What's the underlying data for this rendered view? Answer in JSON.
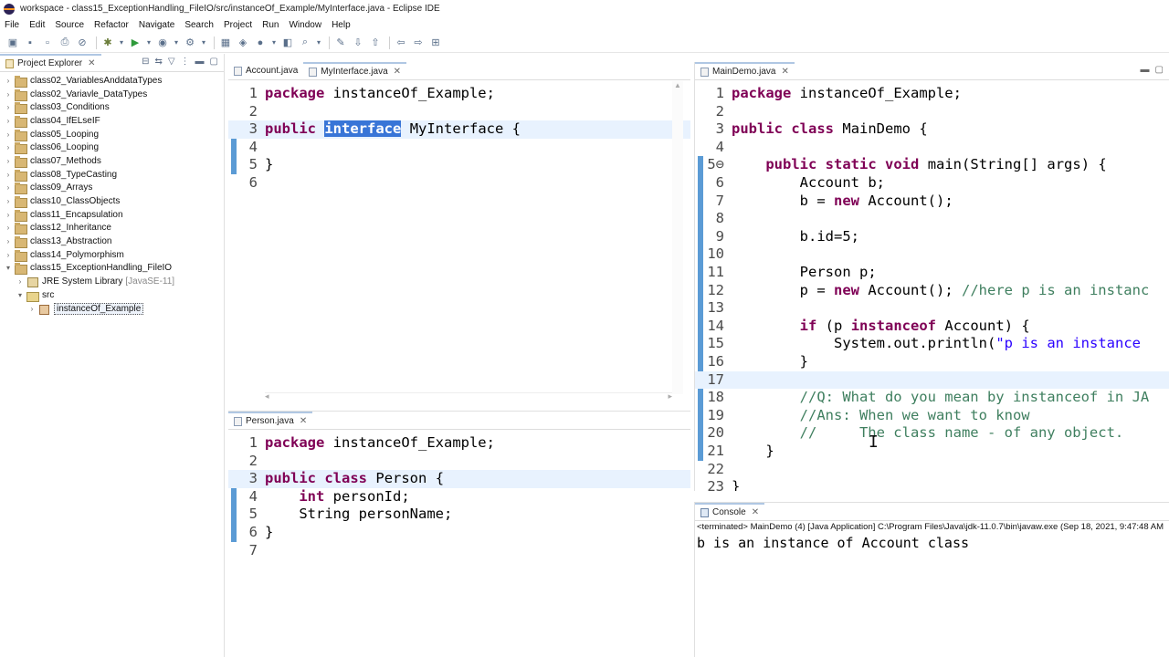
{
  "window": {
    "title": "workspace - class15_ExceptionHandling_FileIO/src/instanceOf_Example/MyInterface.java - Eclipse IDE"
  },
  "menu": [
    "File",
    "Edit",
    "Source",
    "Refactor",
    "Navigate",
    "Search",
    "Project",
    "Run",
    "Window",
    "Help"
  ],
  "toolbar_icons": [
    "new-icon",
    "save-icon",
    "save-all-icon",
    "print-icon",
    "skip-breakpoints-icon",
    "debug-icon",
    "run-icon",
    "coverage-icon",
    "external-tools-icon",
    "new-java-project-icon",
    "new-package-icon",
    "new-class-icon",
    "open-type-icon",
    "search-icon",
    "toggle-mark-occurrences-icon",
    "next-annotation-icon",
    "previous-annotation-icon",
    "back-icon",
    "forward-icon",
    "open-perspective-icon"
  ],
  "explorer": {
    "title": "Project Explorer",
    "items": [
      {
        "label": "class02_VariablesAnddataTypes",
        "depth": 0,
        "type": "project",
        "expanded": false
      },
      {
        "label": "class02_Variavle_DataTypes",
        "depth": 0,
        "type": "project",
        "expanded": false
      },
      {
        "label": "class03_Conditions",
        "depth": 0,
        "type": "project",
        "expanded": false
      },
      {
        "label": "class04_IfELseIF",
        "depth": 0,
        "type": "project",
        "expanded": false
      },
      {
        "label": "class05_Looping",
        "depth": 0,
        "type": "project",
        "expanded": false
      },
      {
        "label": "class06_Looping",
        "depth": 0,
        "type": "project",
        "expanded": false
      },
      {
        "label": "class07_Methods",
        "depth": 0,
        "type": "project",
        "expanded": false
      },
      {
        "label": "class08_TypeCasting",
        "depth": 0,
        "type": "project",
        "expanded": false
      },
      {
        "label": "class09_Arrays",
        "depth": 0,
        "type": "project",
        "expanded": false
      },
      {
        "label": "class10_ClassObjects",
        "depth": 0,
        "type": "project",
        "expanded": false
      },
      {
        "label": "class11_Encapsulation",
        "depth": 0,
        "type": "project",
        "expanded": false
      },
      {
        "label": "class12_Inheritance",
        "depth": 0,
        "type": "project",
        "expanded": false
      },
      {
        "label": "class13_Abstraction",
        "depth": 0,
        "type": "project",
        "expanded": false
      },
      {
        "label": "class14_Polymorphism",
        "depth": 0,
        "type": "project",
        "expanded": false
      },
      {
        "label": "class15_ExceptionHandling_FileIO",
        "depth": 0,
        "type": "project",
        "expanded": true
      },
      {
        "label": "JRE System Library",
        "extra": "[JavaSE-11]",
        "depth": 1,
        "type": "jre",
        "expanded": false
      },
      {
        "label": "src",
        "depth": 1,
        "type": "src",
        "expanded": true
      },
      {
        "label": "instanceOf_Example",
        "depth": 2,
        "type": "pkg",
        "expanded": false,
        "selected": true
      }
    ]
  },
  "editors": {
    "top_left": {
      "tabs": [
        {
          "label": "Account.java",
          "active": false,
          "closable": false
        },
        {
          "label": "MyInterface.java",
          "active": true,
          "closable": true
        }
      ],
      "lines": [
        {
          "n": "1",
          "text": "package instanceOf_Example;"
        },
        {
          "n": "2",
          "text": ""
        },
        {
          "n": "3",
          "text": "public interface MyInterface {"
        },
        {
          "n": "4",
          "text": ""
        },
        {
          "n": "5",
          "text": "}"
        },
        {
          "n": "6",
          "text": ""
        }
      ]
    },
    "bottom_left": {
      "tabs": [
        {
          "label": "Person.java",
          "active": true,
          "closable": true
        }
      ],
      "lines": [
        {
          "n": "1",
          "text": "package instanceOf_Example;"
        },
        {
          "n": "2",
          "text": ""
        },
        {
          "n": "3",
          "text": "public class Person {"
        },
        {
          "n": "4",
          "text": "    int personId;"
        },
        {
          "n": "5",
          "text": "    String personName;"
        },
        {
          "n": "6",
          "text": "}"
        },
        {
          "n": "7",
          "text": ""
        }
      ]
    },
    "right": {
      "tabs": [
        {
          "label": "MainDemo.java",
          "active": true,
          "closable": true
        }
      ],
      "lines": [
        {
          "n": "1",
          "text": "package instanceOf_Example;"
        },
        {
          "n": "2",
          "text": ""
        },
        {
          "n": "3",
          "text": "public class MainDemo {"
        },
        {
          "n": "4",
          "text": ""
        },
        {
          "n": "5⊖",
          "text": "    public static void main(String[] args) {"
        },
        {
          "n": "6",
          "text": "        Account b;"
        },
        {
          "n": "7",
          "text": "        b = new Account();"
        },
        {
          "n": "8",
          "text": ""
        },
        {
          "n": "9",
          "text": "        b.id=5;"
        },
        {
          "n": "10",
          "text": ""
        },
        {
          "n": "11",
          "text": "        Person p;"
        },
        {
          "n": "12",
          "text": "        p = new Account(); //here p is an instanc"
        },
        {
          "n": "13",
          "text": ""
        },
        {
          "n": "14",
          "text": "        if (p instanceof Account) {"
        },
        {
          "n": "15",
          "text": "            System.out.println(\"p is an instance"
        },
        {
          "n": "16",
          "text": "        }"
        },
        {
          "n": "17",
          "text": ""
        },
        {
          "n": "18",
          "text": "        //Q: What do you mean by instanceof in JA"
        },
        {
          "n": "19",
          "text": "        //Ans: When we want to know"
        },
        {
          "n": "20",
          "text": "        //     The class name - of any object."
        },
        {
          "n": "21",
          "text": "    }"
        },
        {
          "n": "22",
          "text": ""
        },
        {
          "n": "23",
          "text": "}"
        }
      ]
    }
  },
  "console": {
    "tab_label": "Console",
    "status": "<terminated> MainDemo (4) [Java Application] C:\\Program Files\\Java\\jdk-11.0.7\\bin\\javaw.exe  (Sep 18, 2021, 9:47:48 AM",
    "output": "b is an instance of Account class"
  },
  "colors": {
    "keyword": "#7f0055",
    "comment": "#3f7f5f",
    "string": "#2a00ff",
    "current_line": "#e8f2fe",
    "selection": "#3875d7",
    "change_bar": "#5b9bd5"
  }
}
